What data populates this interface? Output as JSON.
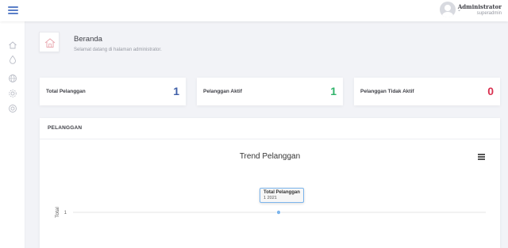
{
  "header": {
    "user_name": "Administrator",
    "user_role": "superadmin",
    "caret": "⌄"
  },
  "sidebar": {
    "icons": [
      "home-icon",
      "drop-icon",
      "globe-icon",
      "settings-icon",
      "life-ring-icon"
    ]
  },
  "page": {
    "title": "Beranda",
    "subtitle": "Selamat datang di halaman administrator."
  },
  "stats": [
    {
      "label": "Total Pelanggan",
      "value": "1",
      "color": "#3f5fa8"
    },
    {
      "label": "Pelanggan Aktif",
      "value": "1",
      "color": "#2fb36a"
    },
    {
      "label": "Pelanggan Tidak Aktif",
      "value": "0",
      "color": "#d9304f"
    }
  ],
  "panel": {
    "title": "PELANGGAN"
  },
  "chart_data": {
    "type": "line",
    "title": "Trend Pelanggan",
    "ylabel": "Total",
    "y_ticks": [
      "1"
    ],
    "series": [
      {
        "name": "Total Pelanggan",
        "points": [
          {
            "x": "2021",
            "y": 1
          }
        ]
      }
    ],
    "tooltip": {
      "title": "Total Pelanggan",
      "value": "1 2021"
    },
    "series_color": "#7cb5ec"
  }
}
